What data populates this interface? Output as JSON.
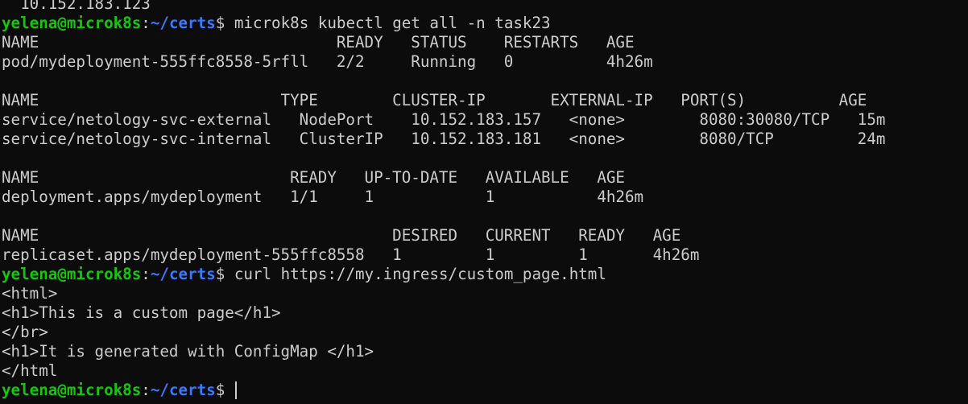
{
  "prompt": {
    "user_host": "yelena@microk8s",
    "separator": ":",
    "path": "~/certs",
    "symbol": "$ "
  },
  "lines": {
    "top_cut": "  10.152.183.123",
    "cmd1": "microk8s kubectl get all -n task23",
    "pods_header": "NAME                                READY   STATUS    RESTARTS   AGE",
    "pod_row": "pod/mydeployment-555ffc8558-5rfll   2/2     Running   0          4h26m",
    "blank1": "",
    "svc_header": "NAME                          TYPE        CLUSTER-IP       EXTERNAL-IP   PORT(S)          AGE",
    "svc_row1": "service/netology-svc-external   NodePort    10.152.183.157   <none>        8080:30080/TCP   15m",
    "svc_row2": "service/netology-svc-internal   ClusterIP   10.152.183.181   <none>        8080/TCP         24m",
    "blank2": "",
    "deploy_header": "NAME                           READY   UP-TO-DATE   AVAILABLE   AGE",
    "deploy_row": "deployment.apps/mydeployment   1/1     1            1           4h26m",
    "blank3": "",
    "rs_header": "NAME                                      DESIRED   CURRENT   READY   AGE",
    "rs_row": "replicaset.apps/mydeployment-555ffc8558   1         1         1       4h26m",
    "cmd2": "curl https://my.ingress/custom_page.html",
    "html_open": "<html>",
    "h1_first": "<h1>This is a custom page</h1>",
    "br": "</br>",
    "h1_second": "<h1>It is generated with ConfigMap </h1>",
    "html_close": "</html"
  },
  "colors": {
    "background": "#0c0c0c",
    "foreground": "#cccccc",
    "user_host": "#16c60c",
    "path": "#3b78ff"
  }
}
